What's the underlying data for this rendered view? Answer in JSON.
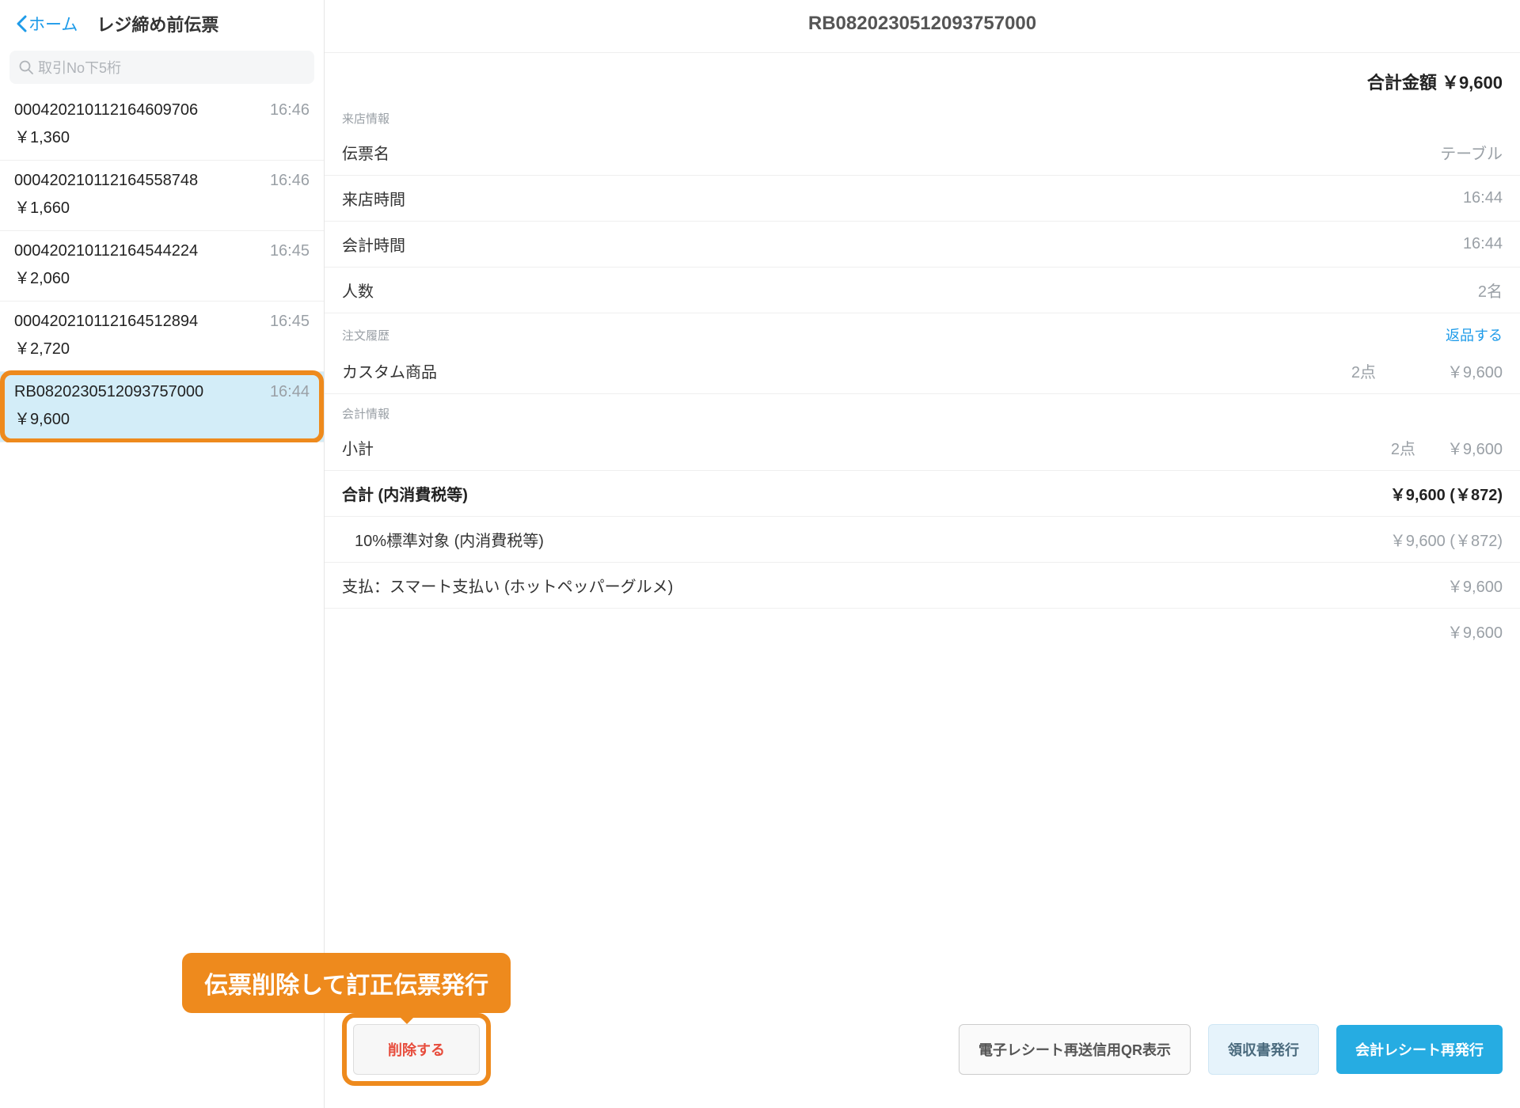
{
  "nav": {
    "back": "ホーム",
    "title": "レジ締め前伝票",
    "search_placeholder": "取引No下5桁"
  },
  "transactions": [
    {
      "id": "00042021011216460 9706",
      "time": "16:46",
      "amount": "￥1,360"
    },
    {
      "id": "00042021011216455 8748",
      "time": "16:46",
      "amount": "￥1,660"
    },
    {
      "id": "00042021011216454 4224",
      "time": "16:45",
      "amount": "￥2,060"
    },
    {
      "id": "0004202101121645128 94",
      "time": "16:45",
      "amount": "￥2,720"
    },
    {
      "id": "RB0820230512093757000",
      "time": "16:44",
      "amount": "￥9,600",
      "selected": true
    }
  ],
  "detail": {
    "id": "RB0820230512093757000",
    "total_label": "合計金額 ￥9,600",
    "sections": {
      "visit": "来店情報",
      "order": "注文履歴",
      "return": "返品する",
      "payment": "会計情報"
    },
    "visit_rows": [
      {
        "lab": "伝票名",
        "val": "テーブル"
      },
      {
        "lab": "来店時間",
        "val": "16:44"
      },
      {
        "lab": "会計時間",
        "val": "16:44"
      },
      {
        "lab": "人数",
        "val": "2名"
      }
    ],
    "orders": [
      {
        "name": "カスタム商品",
        "qty": "2点",
        "amount": "￥9,600"
      }
    ],
    "accounting": [
      {
        "lab": "小計",
        "mid": "2点",
        "val": "￥9,600"
      },
      {
        "lab": "合計 (内消費税等)",
        "val": "￥9,600 (￥872)",
        "bold": true
      },
      {
        "lab": "10%標準対象 (内消費税等)",
        "val": "￥9,600 (￥872)",
        "indent": true
      },
      {
        "lab": "支払：スマート支払い (ホットペッパーグルメ)",
        "val": "￥9,600"
      },
      {
        "lab": "",
        "val": "￥9,600",
        "noborder": true
      }
    ]
  },
  "footer": {
    "delete": "削除する",
    "qr": "電子レシート再送信用QR表示",
    "receipt": "領収書発行",
    "reprint": "会計レシート再発行"
  },
  "callout": "伝票削除して訂正伝票発行"
}
